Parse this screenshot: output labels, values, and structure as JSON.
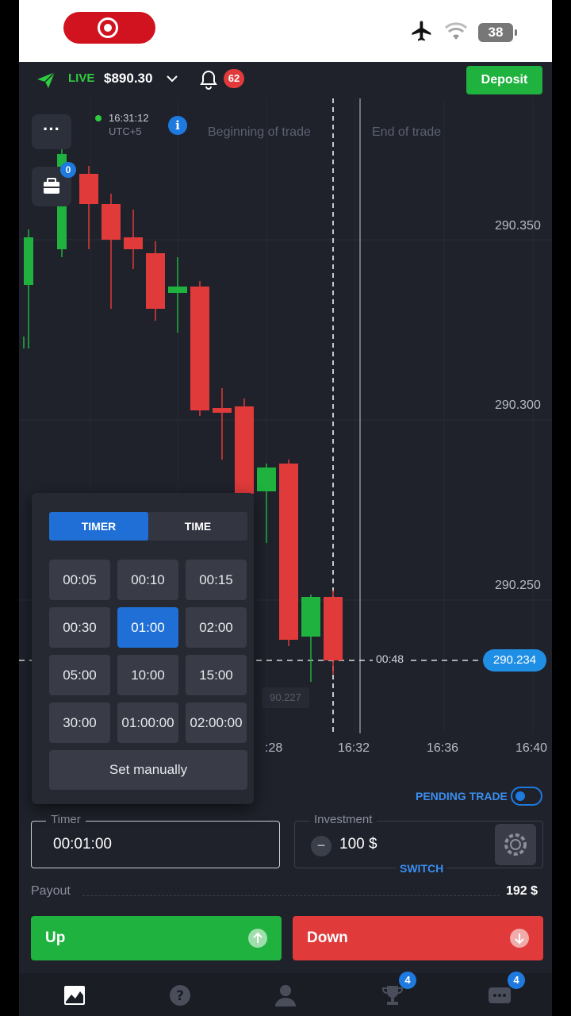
{
  "status_bar": {
    "battery": "38",
    "icons": [
      "screen-record-icon",
      "airplane-icon",
      "wifi-icon",
      "battery-icon"
    ]
  },
  "topbar": {
    "account_type": "LIVE",
    "balance": "$890.30",
    "notifications": "62",
    "deposit_label": "Deposit"
  },
  "chart": {
    "time": "16:31:12",
    "timezone": "UTC+5",
    "portfolio_count": "0",
    "beginning_label": "Beginning of trade",
    "end_label": "End of trade",
    "price_levels": [
      "290.350",
      "290.300",
      "290.250"
    ],
    "current_price": "290.234",
    "countdown": "00:48",
    "ghost_price": "90.227",
    "time_ticks": [
      ":28",
      "16:32",
      "16:36",
      "16:40"
    ],
    "colors": {
      "up": "#1fb23f",
      "down": "#e03a3a",
      "accent": "#1f7ae0"
    }
  },
  "picker": {
    "tabs": [
      "TIMER",
      "TIME"
    ],
    "active_tab": "TIMER",
    "options": [
      "00:05",
      "00:10",
      "00:15",
      "00:30",
      "01:00",
      "02:00",
      "05:00",
      "10:00",
      "15:00",
      "30:00",
      "01:00:00",
      "02:00:00"
    ],
    "selected": "01:00",
    "manual_label": "Set manually"
  },
  "trade": {
    "pending_label": "PENDING TRADE",
    "timer_label": "Timer",
    "timer_value": "00:01:00",
    "investment_label": "Investment",
    "investment_minus": "−",
    "investment_value": "100 $",
    "switch_label": "SWITCH",
    "payout_label": "Payout",
    "payout_value": "192 $",
    "up_label": "Up",
    "down_label": "Down"
  },
  "nav": {
    "tournaments_badge": "4",
    "more_badge": "4"
  }
}
